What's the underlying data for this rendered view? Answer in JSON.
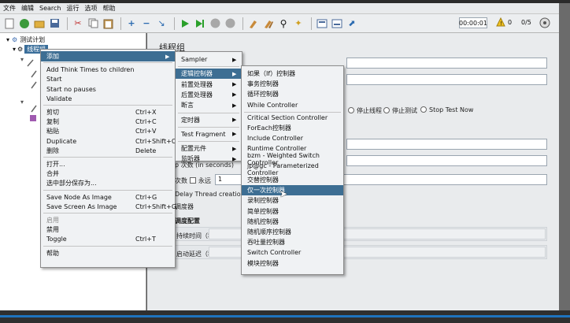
{
  "menubar": [
    "文件",
    "编辑",
    "Search",
    "运行",
    "选项",
    "帮助"
  ],
  "toolbar": {
    "timer": "00:00:01",
    "warnings": "0",
    "threads": "0/5"
  },
  "tree": {
    "root": "测试计划",
    "selected": "线程组"
  },
  "panel": {
    "title": "线程组",
    "radio_options": [
      "停止线程",
      "停止测试",
      "Stop Test Now"
    ],
    "count_label": "次数",
    "forever_label": "永远",
    "count_value": "1",
    "delay_label": "Delay Thread creation un",
    "scheduler_label": "调度器",
    "scheduler_config": "调度配置",
    "duration_label": "持续时间（秒）",
    "delay_start_label": "启动延迟（秒）",
    "loop_fragment": "p 次数 (in seconds)"
  },
  "menu1": {
    "items": [
      {
        "label": "添加",
        "accel": "",
        "submenu": true,
        "highlight": true
      },
      {
        "sep": true
      },
      {
        "label": "Add Think Times to children",
        "accel": ""
      },
      {
        "label": "Start",
        "accel": ""
      },
      {
        "label": "Start no pauses",
        "accel": ""
      },
      {
        "label": "Validate",
        "accel": ""
      },
      {
        "sep": true
      },
      {
        "label": "剪切",
        "accel": "Ctrl+X"
      },
      {
        "label": "复制",
        "accel": "Ctrl+C"
      },
      {
        "label": "粘贴",
        "accel": "Ctrl+V"
      },
      {
        "label": "Duplicate",
        "accel": "Ctrl+Shift+C"
      },
      {
        "label": "删除",
        "accel": "Delete"
      },
      {
        "sep": true
      },
      {
        "label": "打开...",
        "accel": ""
      },
      {
        "label": "合并",
        "accel": ""
      },
      {
        "label": "选中部分保存为...",
        "accel": ""
      },
      {
        "sep": true
      },
      {
        "label": "Save Node As Image",
        "accel": "Ctrl+G"
      },
      {
        "label": "Save Screen As Image",
        "accel": "Ctrl+Shift+G"
      },
      {
        "sep": true
      },
      {
        "label": "启用",
        "accel": "",
        "disabled": true
      },
      {
        "label": "禁用",
        "accel": ""
      },
      {
        "label": "Toggle",
        "accel": "Ctrl+T"
      },
      {
        "sep": true
      },
      {
        "label": "帮助",
        "accel": ""
      }
    ]
  },
  "menu2": {
    "items": [
      {
        "label": "Sampler",
        "submenu": true
      },
      {
        "sep": true
      },
      {
        "label": "逻辑控制器",
        "submenu": true,
        "highlight": true
      },
      {
        "label": "前置处理器",
        "submenu": true
      },
      {
        "label": "后置处理器",
        "submenu": true
      },
      {
        "label": "断言",
        "submenu": true
      },
      {
        "sep": true
      },
      {
        "label": "定时器",
        "submenu": true
      },
      {
        "sep": true
      },
      {
        "label": "Test Fragment",
        "submenu": true
      },
      {
        "sep": true
      },
      {
        "label": "配置元件",
        "submenu": true
      },
      {
        "label": "监听器",
        "submenu": true
      }
    ]
  },
  "menu3": {
    "items": [
      {
        "label": "如果（If）控制器"
      },
      {
        "label": "事务控制器"
      },
      {
        "label": "循环控制器"
      },
      {
        "label": "While Controller"
      },
      {
        "sep": true
      },
      {
        "label": "Critical Section Controller"
      },
      {
        "label": "ForEach控制器"
      },
      {
        "label": "Include Controller"
      },
      {
        "label": "Runtime Controller"
      },
      {
        "label": "bzm - Weighted Switch Controller"
      },
      {
        "label": "jp@gc - Parameterized Controller"
      },
      {
        "label": "交替控制器"
      },
      {
        "label": "仅一次控制器",
        "highlight": true
      },
      {
        "label": "录制控制器"
      },
      {
        "label": "简单控制器"
      },
      {
        "label": "随机控制器"
      },
      {
        "label": "随机顺序控制器"
      },
      {
        "label": "吞吐量控制器"
      },
      {
        "label": "Switch Controller"
      },
      {
        "label": "模块控制器"
      }
    ]
  }
}
